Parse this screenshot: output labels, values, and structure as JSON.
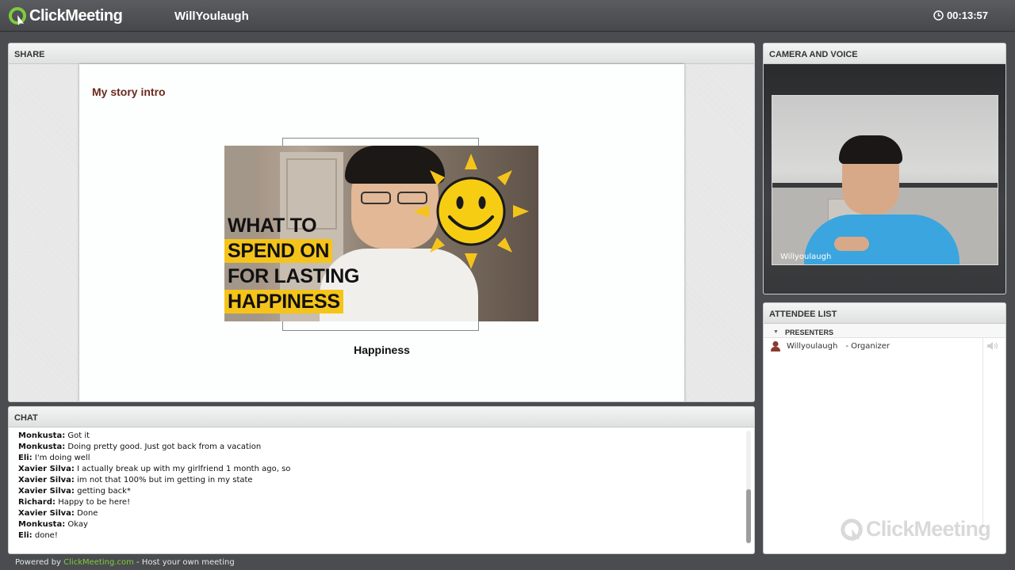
{
  "app": {
    "brand": "ClickMeeting",
    "meeting_title": "WillYoulaugh",
    "timer": "00:13:57"
  },
  "share": {
    "header": "SHARE",
    "slide_title": "My story intro",
    "thumbnail_lines": [
      "WHAT TO",
      "SPEND ON",
      "FOR LASTING",
      "HAPPINESS"
    ],
    "caption": "Happiness"
  },
  "camera": {
    "header": "CAMERA AND VOICE",
    "video_label": "Willyoulaugh"
  },
  "chat": {
    "header": "CHAT",
    "messages": [
      {
        "sender": "Monkusta:",
        "text": "Got it"
      },
      {
        "sender": "Monkusta:",
        "text": "Doing pretty good. Just got back from a vacation"
      },
      {
        "sender": "Eli:",
        "text": "I'm doing well"
      },
      {
        "sender": "Xavier Silva:",
        "text": "I actually break up with my girlfriend 1 month ago, so"
      },
      {
        "sender": "Xavier Silva:",
        "text": "im not that 100% but im getting in my state"
      },
      {
        "sender": "Xavier Silva:",
        "text": "getting back*"
      },
      {
        "sender": "Richard:",
        "text": "Happy to be here!"
      },
      {
        "sender": "Xavier Silva:",
        "text": "Done"
      },
      {
        "sender": "Monkusta:",
        "text": "Okay"
      },
      {
        "sender": "Eli:",
        "text": "done!"
      }
    ]
  },
  "attendees": {
    "header": "ATTENDEE LIST",
    "group_label": "PRESENTERS",
    "list": [
      {
        "name": "Willyoulaugh",
        "role": "- Organizer"
      }
    ],
    "watermark": "ClickMeeting"
  },
  "footer": {
    "prefix": "Powered by",
    "link": "ClickMeeting.com",
    "suffix": "- Host your own meeting"
  },
  "colors": {
    "brand_green": "#7fcc3c",
    "slide_title": "#6b2a1e",
    "thumb_yellow": "#f5c41a"
  },
  "icons": [
    "clickmeeting-logo-icon",
    "clock-icon",
    "person-icon",
    "speaker-icon",
    "sun-smiley-icon"
  ]
}
